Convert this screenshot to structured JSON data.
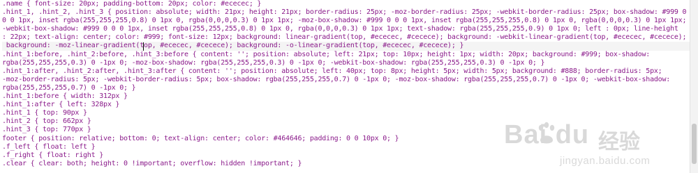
{
  "editor": {
    "lines": [
      ".name { font-size: 20px; padding-bottom: 20px; color: #ececec; }",
      ".hint_1, .hint_2, .hint_3 { position: absolute; width: 21px; height: 21px; border-radius: 25px; -moz-border-radius: 25px; -webkit-border-radius: 25px; box-shadow: #999 0",
      "0 0 1px, inset rgba(255,255,255,0.8) 0 1px 0, rgba(0,0,0,0.3) 0 1px 1px; -moz-box-shadow: #999 0 0 0 1px, inset rgba(255,255,255,0.8) 0 1px 0, rgba(0,0,0,0.3) 0 1px 1px;",
      "-webkit-box-shadow: #999 0 0 0 1px, inset rgba(255,255,255,0.8) 0 1px 0, rgba(0,0,0,0.3) 0 1px 1px; text-shadow: rgba(255,255,255,0.9) 0 1px 0; left : 0px; line-height",
      ": 22px; text-align: center; color: #999; font-size: 12px; background: linear-gradient(top, #ececec, #cecece); background: -webkit-linear-gradient(top, #ececec, #cecece);",
      " background: -moz-linear-gradient(top, #ececec, #cecece); background: -o-linear-gradient(top, #ececec, #cecece); }",
      ".hint_1:before, .hint_2:before, .hint_3:before { content: ''; position: absolute; left: 21px; top: 10px; height: 1px; width: 20px; background: #999; box-shadow:",
      "rgba(255,255,255,0.3) 0 -1px 0; -moz-box-shadow: rgba(255,255,255,0.3) 0 -1px 0; -webkit-box-shadow: rgba(255,255,255,0.3) 0 -1px 0; }",
      ".hint_1:after, .hint_2:after, .hint_3:after { content: ''; position: absolute; left: 40px; top: 8px; height: 5px; width: 5px; background: #888; border-radius: 5px;",
      "-moz-border-radius: 5px; -webkit-border-radius: 5px; box-shadow: rgba(255,255,255,0.7) 0 -1px 0; -moz-box-shadow: rgba(255,255,255,0.7) 0 -1px 0; -webkit-box-shadow:",
      "rgba(255,255,255,0.7) 0 -1px 0; }",
      ".hint_1:before { width: 312px }",
      ".hint_1:after { left: 328px }",
      ".hint_1 { top: 90px }",
      ".hint_2 { top: 662px }",
      ".hint_3 { top: 770px }",
      "footer { position: relative; bottom: 0; text-align: center; color: #464646; padding: 0 0 10px 0; }",
      ".f_left { float: left }",
      ".f_right { float: right }",
      ".clear { clear: both; height: 0 !important; overflow: hidden !important; }"
    ]
  },
  "watermark": {
    "brand": "Bai du",
    "brand_cn": "经验",
    "url": "jingyan.baidu.com",
    "icon": "baidu-paw-icon"
  },
  "colors": {
    "code_text": "#8a1a8a",
    "background": "#ffffff"
  }
}
